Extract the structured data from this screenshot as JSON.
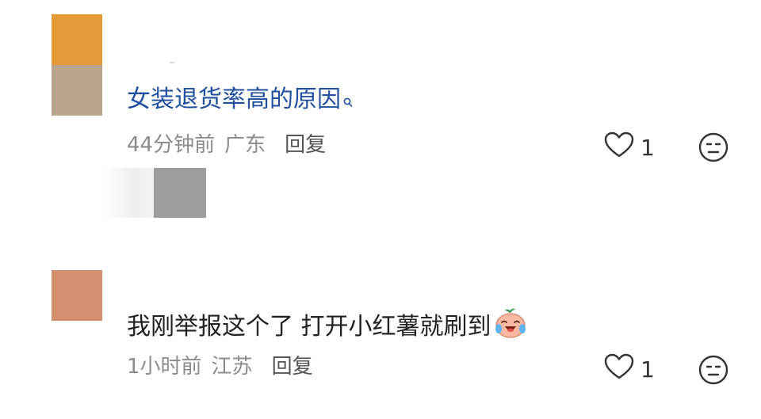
{
  "comments": [
    {
      "text": "女装退货率高的原因",
      "search_icon": "search-suggest-icon",
      "time": "44分钟前",
      "location": "广东",
      "reply_label": "回复",
      "like_count": "1",
      "like_icon": "heart-outline-icon",
      "react_icon": "neutral-face-icon",
      "avatar_colors": [
        "#e59a3a",
        "#b9a68c"
      ]
    },
    {
      "text": "我刚举报这个了 打开小红薯就刷到",
      "emoji": "crying-sweet-potato-emoji",
      "time": "1小时前",
      "location": "江苏",
      "reply_label": "回复",
      "like_count": "1",
      "like_icon": "heart-outline-icon",
      "react_icon": "neutral-face-icon",
      "avatar_colors": [
        "#d4906e"
      ]
    }
  ],
  "colors": {
    "link_text": "#1f4f9e",
    "meta_text": "#8c8c8c",
    "body_text": "#222222"
  }
}
